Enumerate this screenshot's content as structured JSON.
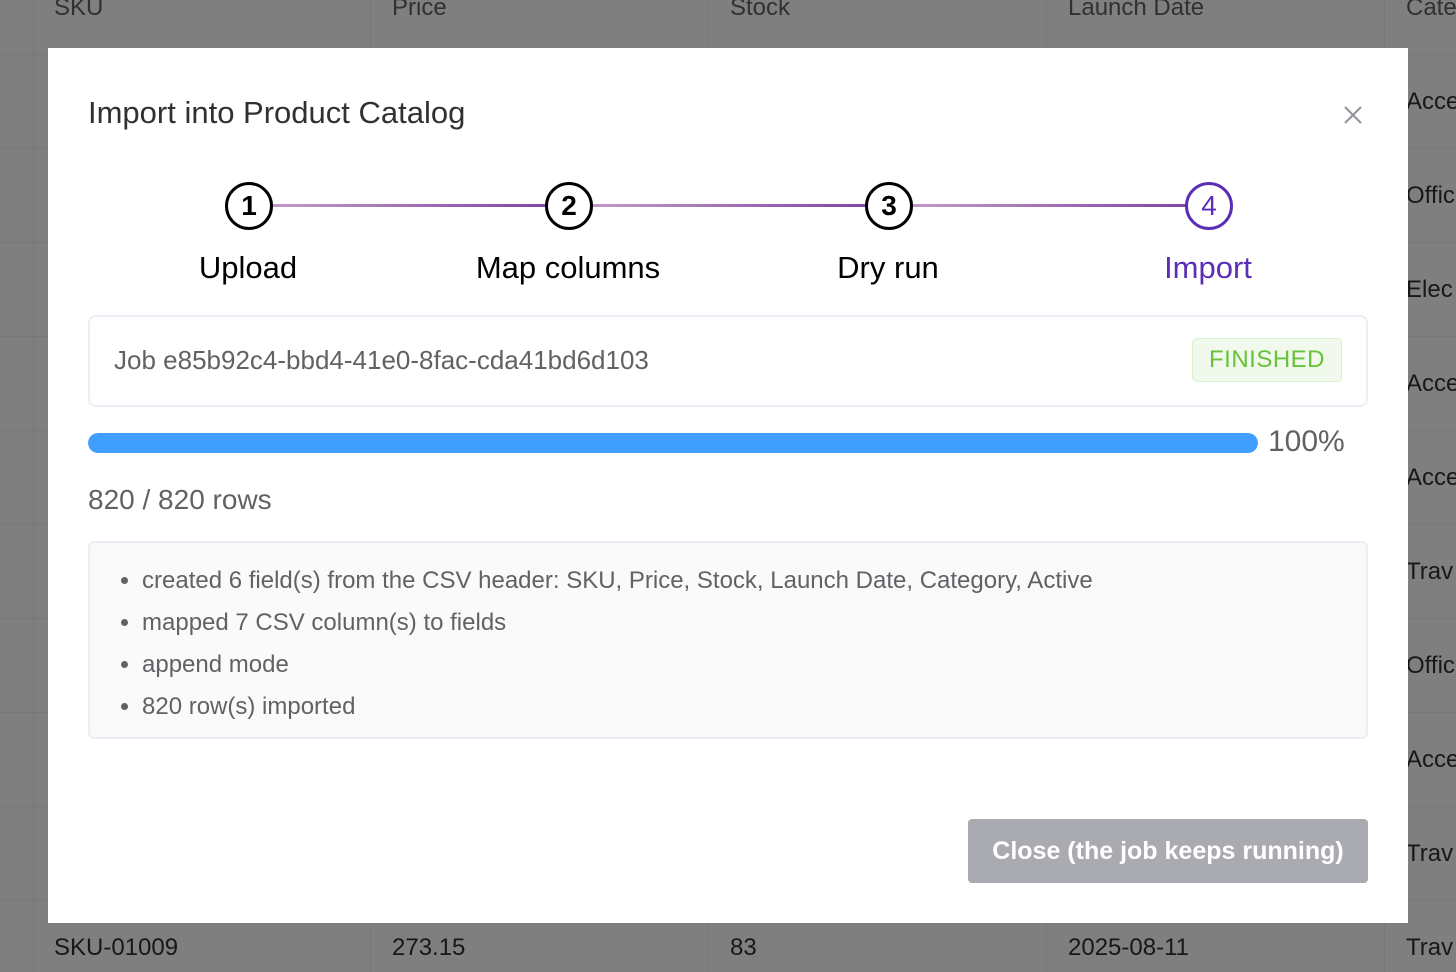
{
  "background_table": {
    "headers": [
      "SKU",
      "Price",
      "Stock",
      "Launch Date",
      "Cate"
    ],
    "category_column_visible": [
      "Acce",
      "Offic",
      "Elec",
      "Acce",
      "Acce",
      "Trav",
      "Offic",
      "Acce",
      "Trav"
    ],
    "last_row": {
      "sku": "SKU-01009",
      "price": "273.15",
      "stock": "83",
      "launch_date": "2025-08-11",
      "category": "Trav"
    }
  },
  "modal": {
    "title": "Import into Product Catalog",
    "close_icon": "close-icon",
    "steps": [
      {
        "number": "1",
        "label": "Upload"
      },
      {
        "number": "2",
        "label": "Map columns"
      },
      {
        "number": "3",
        "label": "Dry run"
      },
      {
        "number": "4",
        "label": "Import",
        "active": true
      }
    ],
    "job": {
      "text": "Job e85b92c4-bbd4-41e0-8fac-cda41bd6d103",
      "status": "FINISHED"
    },
    "progress": {
      "percent": 100,
      "label": "100%"
    },
    "rows_text": "820 / 820 rows",
    "log_items": [
      "created 6 field(s) from the CSV header: SKU, Price, Stock, Launch Date, Category, Active",
      "mapped 7 CSV column(s) to fields",
      "append mode",
      "820 row(s) imported"
    ],
    "close_button_label": "Close (the job keeps running)"
  },
  "colors": {
    "accent": "#5b2fb5",
    "progress": "#409eff",
    "success": "#67c23a",
    "button_disabled": "#a9abb1"
  }
}
